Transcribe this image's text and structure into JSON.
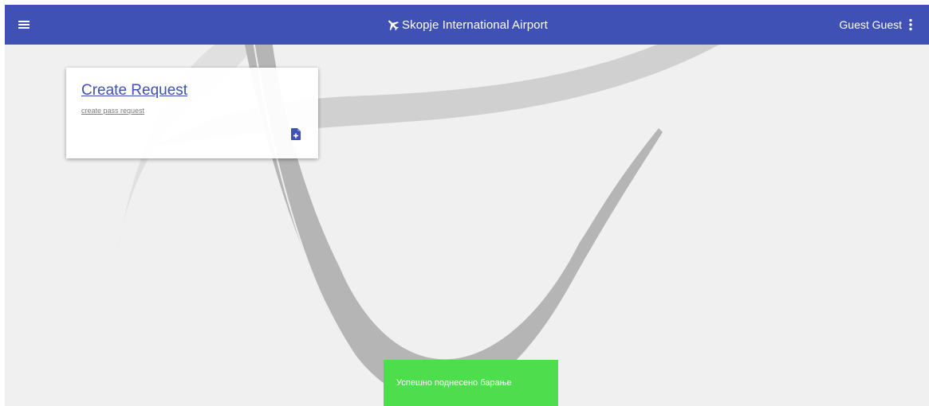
{
  "toolbar": {
    "title": "Skopje International Airport",
    "user_name": "Guest Guest",
    "menu_icon": "menu-icon",
    "title_icon": "airplane-icon",
    "user_menu_icon": "more-vert-icon",
    "color": "#3f51b5"
  },
  "card": {
    "title": "Create Request",
    "subtitle": "create pass request",
    "action_icon": "note-add-icon"
  },
  "snackbar": {
    "message": "Успешно поднесено барање",
    "color": "#4ddd4d"
  }
}
